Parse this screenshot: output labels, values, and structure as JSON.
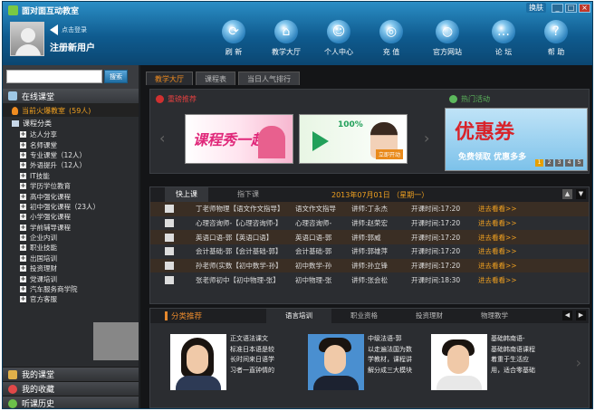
{
  "app": {
    "title": "面对面互动教室"
  },
  "window": {
    "skin_label": "换肤",
    "min": "_",
    "max": "□",
    "close": "×"
  },
  "user": {
    "login_hint": "点击登录",
    "register": "注册新用户"
  },
  "nav": [
    {
      "label": "刷 新",
      "icon": "refresh-icon",
      "glyph": "⟳"
    },
    {
      "label": "教学大厅",
      "icon": "home-icon",
      "glyph": "⌂"
    },
    {
      "label": "个人中心",
      "icon": "person-icon",
      "glyph": "☺"
    },
    {
      "label": "充 值",
      "icon": "coins-icon",
      "glyph": "◎"
    },
    {
      "label": "官方网站",
      "icon": "globe-icon",
      "glyph": "◍"
    },
    {
      "label": "论 坛",
      "icon": "chat-icon",
      "glyph": "…"
    },
    {
      "label": "帮 助",
      "icon": "help-icon",
      "glyph": "?"
    }
  ],
  "search": {
    "button": "搜索",
    "value": ""
  },
  "sidebar": {
    "online_label": "在线课堂",
    "hot_label": "当前火爆教室",
    "hot_count": "(59人)",
    "cat_label": "课程分类",
    "categories": [
      "达人分享",
      "名师课堂",
      "专业课堂（12人）",
      "外语提升（12人）",
      "IT技能",
      "学历学位教育",
      "高中强化课程",
      "初中强化课程（23人）",
      "小学强化课程",
      "学前辅导课程",
      "企业内训",
      "职业技能",
      "出国培训",
      "投资理财",
      "党课培训",
      "汽车服务商学院",
      "官方客服"
    ],
    "bottom": [
      "我的课堂",
      "我的收藏",
      "听课历史"
    ]
  },
  "main": {
    "tabs": [
      "教学大厅",
      "课程表",
      "当日人气排行"
    ],
    "recommend_label": "重磅推荐",
    "activity_label": "热门活动",
    "banner1_text": "课程秀一起",
    "banner2_pct": "100%",
    "banner2_join": "立即开动",
    "promo_title": "优惠券",
    "promo_sub": "免费领取  优惠多多",
    "promo_pages": [
      "1",
      "2",
      "3",
      "4",
      "5"
    ]
  },
  "schedule": {
    "tabs": [
      "快上课",
      "指下课"
    ],
    "date": "2013年07月01日 （星期一）",
    "rows": [
      {
        "title": "丁老师物理【语文作文指导】",
        "category": "语文作文指导",
        "teacher": "讲师:丁永杰",
        "time": "开课时间:17:20",
        "action": "进去看看>>"
      },
      {
        "title": "心理咨询师-【心理咨询师-】",
        "category": "心理咨询师-",
        "teacher": "讲师:赵荣宏",
        "time": "开课时间:17:20",
        "action": "进去看看>>"
      },
      {
        "title": "英语口语-郭【英语口语】",
        "category": "英语口语-郭",
        "teacher": "讲师:郭威",
        "time": "开课时间:17:20",
        "action": "进去看看>>"
      },
      {
        "title": "会计基础-郭【会计基础-郭】",
        "category": "会计基础-郭",
        "teacher": "讲师:郭雄萍",
        "time": "开课时间:17:20",
        "action": "进去看看>>"
      },
      {
        "title": "孙老师(实数【初中数学-孙】",
        "category": "初中数学-孙",
        "teacher": "讲师:孙立锋",
        "time": "开课时间:17:20",
        "action": "进去看看>>"
      },
      {
        "title": "张老师初中【初中物理-张】",
        "category": "初中物理-张",
        "teacher": "讲师:张会松",
        "time": "开课时间:18:30",
        "action": "进去看看>>"
      }
    ]
  },
  "categories_panel": {
    "title": "分类推荐",
    "tabs": [
      "语言培训",
      "职业资格",
      "投资理财",
      "物理教学"
    ],
    "teachers": [
      {
        "lines": [
          "正文语法课文",
          "标准日本语是较",
          "长时间来日语学",
          "习者一直钟情的"
        ]
      },
      {
        "lines": [
          "中级法语-郭",
          "以走遍法国为数",
          "学教材，课程讲",
          "解分成三大模块"
        ]
      },
      {
        "lines": [
          "基础韩南语-",
          "基础韩南语课程",
          "着重于生活应",
          "用，适合零基础"
        ]
      }
    ]
  }
}
